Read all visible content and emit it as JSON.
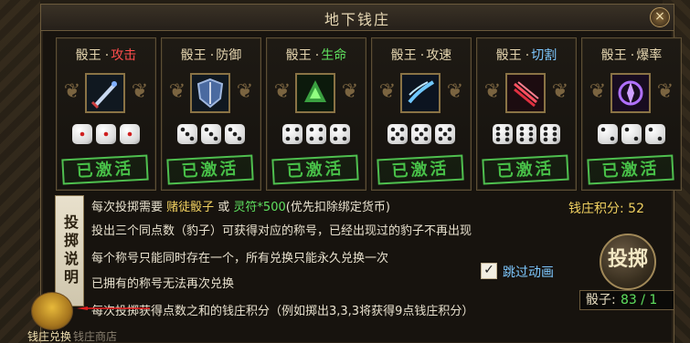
{
  "window": {
    "title": "地下钱庄",
    "close_label": "×"
  },
  "cards": [
    {
      "prefix": "骰王",
      "sep": "·",
      "stat": "攻击",
      "stat_color": "#ff4d4d",
      "icon": "sword-icon",
      "stamp": "已激活",
      "dice": [
        1,
        1,
        1
      ]
    },
    {
      "prefix": "骰王",
      "sep": "·",
      "stat": "防御",
      "stat_color": "#e6d6b0",
      "icon": "shield-icon",
      "stamp": "已激活",
      "dice": [
        3,
        3,
        3
      ]
    },
    {
      "prefix": "骰王",
      "sep": "·",
      "stat": "生命",
      "stat_color": "#5fe05f",
      "icon": "life-icon",
      "stamp": "已激活",
      "dice": [
        4,
        4,
        4
      ]
    },
    {
      "prefix": "骰王",
      "sep": "·",
      "stat": "攻速",
      "stat_color": "#e6d6b0",
      "icon": "speed-icon",
      "stamp": "已激活",
      "dice": [
        5,
        5,
        5
      ]
    },
    {
      "prefix": "骰王",
      "sep": "·",
      "stat": "切割",
      "stat_color": "#7ec8ff",
      "icon": "cut-icon",
      "stamp": "已激活",
      "dice": [
        6,
        6,
        6
      ]
    },
    {
      "prefix": "骰王",
      "sep": "·",
      "stat": "爆率",
      "stat_color": "#e6d6b0",
      "icon": "drop-icon",
      "stamp": "已激活",
      "dice": [
        2,
        2,
        2
      ]
    }
  ],
  "explain_tab": "投掷说明",
  "rules": {
    "line1_a": "每次投掷需要 ",
    "line1_b": "赌徒骰子",
    "line1_c": " 或 ",
    "line1_d": "灵符*500",
    "line1_e": "(优先扣除绑定货币)",
    "line2": "投出三个同点数（豹子）可获得对应的称号，已经出现过的豹子不再出现",
    "line3": "每个称号只能同时存在一个，所有兑换只能永久兑换一次",
    "line4": "已拥有的称号无法再次兑换",
    "line5": "每次投掷获得点数之和的钱庄积分（例如掷出3,3,3将获得9点钱庄积分）"
  },
  "score": {
    "label": "钱庄积分: ",
    "value": "52"
  },
  "roll_button": "投掷",
  "skip_animation": {
    "label": "跳过动画",
    "checked": true,
    "mark": "✓"
  },
  "dice_count": {
    "label": "骰子:",
    "value": "83 / 1"
  },
  "bank_exchange": {
    "label": "钱庄兑换",
    "label2": "钱庄商店"
  },
  "colors": {
    "accent": "#f0d060",
    "green": "#5fe05f",
    "blue": "#7ec8ff",
    "red": "#ff4d4d"
  }
}
